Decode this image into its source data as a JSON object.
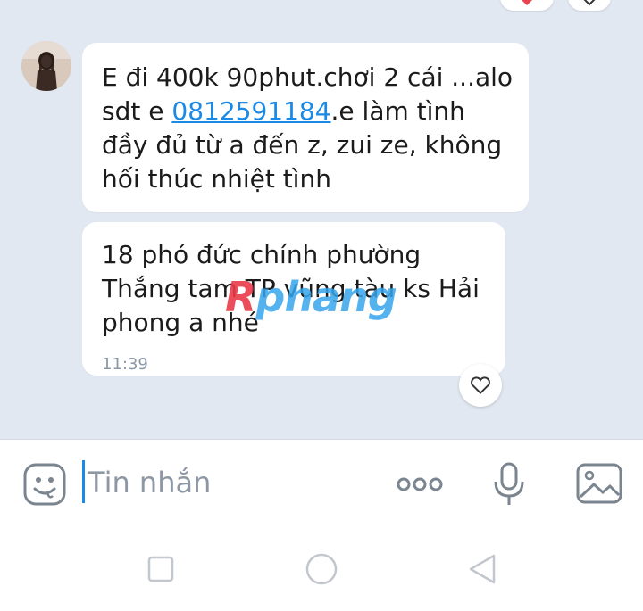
{
  "chat": {
    "messages": [
      {
        "line1": "E đi 400k 90phut.chơi 2 cái ...alo",
        "line2_prefix": "sdt e ",
        "phone": "0812591184",
        "line2_suffix": ".e làm tình",
        "line3": "đầy đủ từ a đến z, zui ze, không",
        "line4": "hối thúc nhiệt tình"
      },
      {
        "line1": "18 phó đức chính phường",
        "line2": "Thắng tam TP vũng tàu ks Hải",
        "line3": "phong a nhé",
        "time": "11:39"
      }
    ],
    "watermark": "Rphang",
    "watermark_first": "R",
    "watermark_rest": "phang"
  },
  "composer": {
    "placeholder": "Tin nhắn",
    "icons": [
      "emoji-icon",
      "more-icon",
      "mic-icon",
      "image-icon"
    ]
  },
  "colors": {
    "chat_bg": "#e2e8f1",
    "link": "#1a8ae6",
    "heart_red": "#e8434e"
  }
}
